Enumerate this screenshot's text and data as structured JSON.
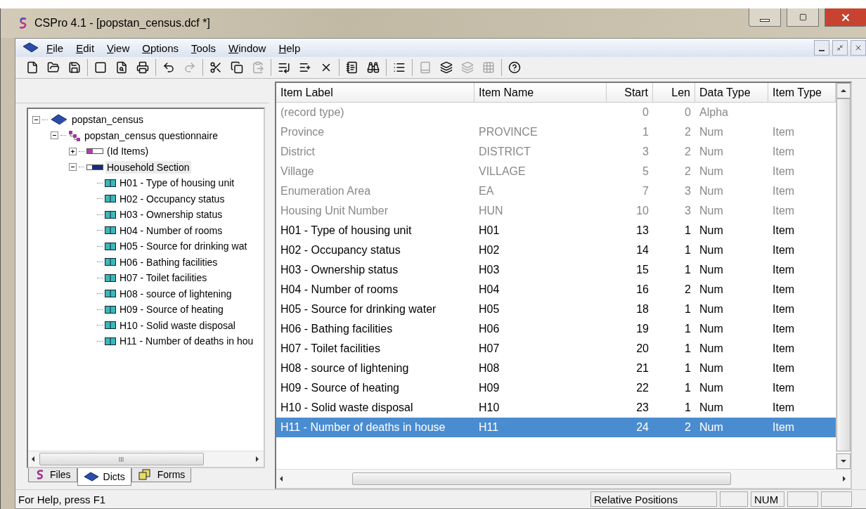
{
  "window": {
    "title": "CSPro 4.1 - [popstan_census.dcf *]"
  },
  "menu": [
    {
      "label": "File"
    },
    {
      "label": "Edit"
    },
    {
      "label": "View"
    },
    {
      "label": "Options"
    },
    {
      "label": "Tools"
    },
    {
      "label": "Window"
    },
    {
      "label": "Help"
    }
  ],
  "toolbar": [
    {
      "kind": "new",
      "disabled": false
    },
    {
      "kind": "open",
      "disabled": false
    },
    {
      "kind": "save",
      "disabled": false
    },
    {
      "kind": "sep"
    },
    {
      "kind": "frame",
      "disabled": false
    },
    {
      "kind": "preview",
      "disabled": false
    },
    {
      "kind": "print",
      "disabled": false
    },
    {
      "kind": "sep"
    },
    {
      "kind": "undo",
      "disabled": false
    },
    {
      "kind": "redo",
      "disabled": true
    },
    {
      "kind": "sep"
    },
    {
      "kind": "cut",
      "disabled": false
    },
    {
      "kind": "copy",
      "disabled": false
    },
    {
      "kind": "paste",
      "disabled": true
    },
    {
      "kind": "sep"
    },
    {
      "kind": "addafter",
      "disabled": false
    },
    {
      "kind": "addbefore",
      "disabled": false
    },
    {
      "kind": "delete",
      "disabled": false
    },
    {
      "kind": "sep"
    },
    {
      "kind": "notes",
      "disabled": false
    },
    {
      "kind": "find",
      "disabled": false
    },
    {
      "kind": "sep"
    },
    {
      "kind": "layout",
      "disabled": false
    },
    {
      "kind": "sep"
    },
    {
      "kind": "book",
      "disabled": true
    },
    {
      "kind": "stack",
      "disabled": false
    },
    {
      "kind": "stack",
      "disabled": true
    },
    {
      "kind": "grid",
      "disabled": true
    },
    {
      "kind": "sep"
    },
    {
      "kind": "help",
      "disabled": false
    }
  ],
  "tree": [
    {
      "label": "popstan_census",
      "kind": "dict",
      "expanded": true,
      "selected": false,
      "children": [
        {
          "label": "popstan_census questionnaire",
          "kind": "level",
          "expanded": true,
          "selected": false,
          "children": [
            {
              "label": "(Id Items)",
              "kind": "idrecord",
              "expanded": false,
              "selected": false
            },
            {
              "label": "Household Section",
              "kind": "record",
              "expanded": true,
              "selected": true,
              "children": [
                {
                  "label": "H01 - Type of housing unit",
                  "kind": "item",
                  "selected": false
                },
                {
                  "label": "H02 - Occupancy status",
                  "kind": "item",
                  "selected": false
                },
                {
                  "label": "H03 - Ownership status",
                  "kind": "item",
                  "selected": false
                },
                {
                  "label": "H04 - Number of rooms",
                  "kind": "item",
                  "selected": false
                },
                {
                  "label": "H05 - Source for drinking wat",
                  "kind": "item",
                  "selected": false
                },
                {
                  "label": "H06 - Bathing facilities",
                  "kind": "item",
                  "selected": false
                },
                {
                  "label": "H07 - Toilet facilities",
                  "kind": "item",
                  "selected": false
                },
                {
                  "label": "H08 - source of lightening",
                  "kind": "item",
                  "selected": false
                },
                {
                  "label": "H09 - Source of heating",
                  "kind": "item",
                  "selected": false
                },
                {
                  "label": "H10 - Solid waste disposal",
                  "kind": "item",
                  "selected": false
                },
                {
                  "label": "H11 - Number of deaths in hou",
                  "kind": "item",
                  "selected": false
                }
              ]
            }
          ]
        }
      ]
    }
  ],
  "left_tabs": [
    {
      "label": "Files",
      "kind": "files",
      "selected": false
    },
    {
      "label": "Dicts",
      "kind": "dicts",
      "selected": true
    },
    {
      "label": "Forms",
      "kind": "forms",
      "selected": false
    }
  ],
  "table": {
    "columns": [
      "Item Label",
      "Item Name",
      "Start",
      "Len",
      "Data Type",
      "Item Type"
    ],
    "rows": [
      {
        "kind": "id",
        "selected": false,
        "cells": [
          "(record type)",
          "",
          "0",
          "0",
          "Alpha",
          ""
        ]
      },
      {
        "kind": "id",
        "selected": false,
        "cells": [
          "Province",
          "PROVINCE",
          "1",
          "2",
          "Num",
          "Item"
        ]
      },
      {
        "kind": "id",
        "selected": false,
        "cells": [
          "District",
          "DISTRICT",
          "3",
          "2",
          "Num",
          "Item"
        ]
      },
      {
        "kind": "id",
        "selected": false,
        "cells": [
          "Village",
          "VILLAGE",
          "5",
          "2",
          "Num",
          "Item"
        ]
      },
      {
        "kind": "id",
        "selected": false,
        "cells": [
          "Enumeration Area",
          "EA",
          "7",
          "3",
          "Num",
          "Item"
        ]
      },
      {
        "kind": "id",
        "selected": false,
        "cells": [
          "Housing Unit Number",
          "HUN",
          "10",
          "3",
          "Num",
          "Item"
        ]
      },
      {
        "kind": "item",
        "selected": false,
        "cells": [
          "H01 - Type of housing unit",
          "H01",
          "13",
          "1",
          "Num",
          "Item"
        ]
      },
      {
        "kind": "item",
        "selected": false,
        "cells": [
          "H02 - Occupancy status",
          "H02",
          "14",
          "1",
          "Num",
          "Item"
        ]
      },
      {
        "kind": "item",
        "selected": false,
        "cells": [
          "H03 - Ownership status",
          "H03",
          "15",
          "1",
          "Num",
          "Item"
        ]
      },
      {
        "kind": "item",
        "selected": false,
        "cells": [
          "H04 - Number of rooms",
          "H04",
          "16",
          "2",
          "Num",
          "Item"
        ]
      },
      {
        "kind": "item",
        "selected": false,
        "cells": [
          "H05 - Source for drinking water",
          "H05",
          "18",
          "1",
          "Num",
          "Item"
        ]
      },
      {
        "kind": "item",
        "selected": false,
        "cells": [
          "H06 - Bathing facilities",
          "H06",
          "19",
          "1",
          "Num",
          "Item"
        ]
      },
      {
        "kind": "item",
        "selected": false,
        "cells": [
          "H07 - Toilet facilities",
          "H07",
          "20",
          "1",
          "Num",
          "Item"
        ]
      },
      {
        "kind": "item",
        "selected": false,
        "cells": [
          "H08 - source of lightening",
          "H08",
          "21",
          "1",
          "Num",
          "Item"
        ]
      },
      {
        "kind": "item",
        "selected": false,
        "cells": [
          "H09 - Source of heating",
          "H09",
          "22",
          "1",
          "Num",
          "Item"
        ]
      },
      {
        "kind": "item",
        "selected": false,
        "cells": [
          "H10 - Solid waste disposal",
          "H10",
          "23",
          "1",
          "Num",
          "Item"
        ]
      },
      {
        "kind": "item",
        "selected": true,
        "cells": [
          "H11 - Number of deaths in house",
          "H11",
          "24",
          "2",
          "Num",
          "Item"
        ]
      }
    ]
  },
  "status_bar": {
    "message": "For Help, press F1",
    "panes": [
      {
        "text": "Relative Positions"
      },
      {
        "kind": "blank"
      },
      {
        "text": "NUM"
      },
      {
        "kind": "blank"
      },
      {
        "kind": "blank"
      }
    ]
  }
}
